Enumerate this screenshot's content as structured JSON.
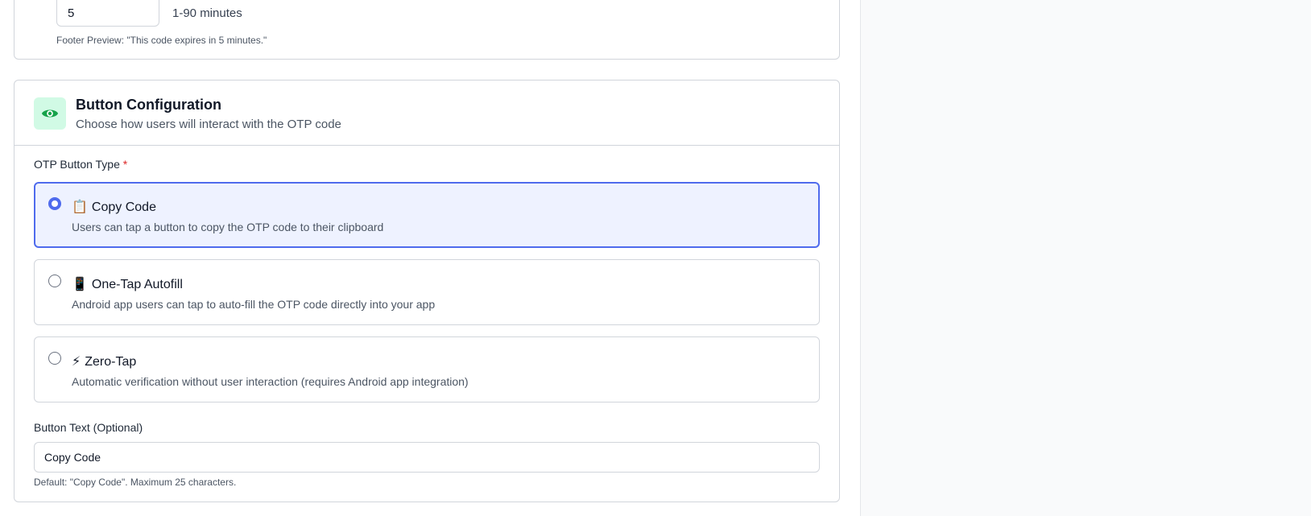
{
  "expiry": {
    "value": "5",
    "range_hint": "1-90 minutes",
    "footer_preview": "Footer Preview: \"This code expires in 5 minutes.\""
  },
  "button_config": {
    "icon": "eye-icon",
    "icon_color": "#16a34a",
    "title": "Button Configuration",
    "subtitle": "Choose how users will interact with the OTP code",
    "type_label": "OTP Button Type",
    "required_marker": "*",
    "options": [
      {
        "emoji": "📋",
        "title": "Copy Code",
        "description": "Users can tap a button to copy the OTP code to their clipboard",
        "selected": true
      },
      {
        "emoji": "📱",
        "title": "One-Tap Autofill",
        "description": "Android app users can tap to auto-fill the OTP code directly into your app",
        "selected": false
      },
      {
        "emoji": "⚡",
        "title": "Zero-Tap",
        "description": "Automatic verification without user interaction (requires Android app integration)",
        "selected": false
      }
    ],
    "button_text_label": "Button Text (Optional)",
    "button_text_value": "Copy Code",
    "button_text_hint": "Default: \"Copy Code\". Maximum 25 characters."
  },
  "colors": {
    "accent": "#4f6bed",
    "selected_bg": "#eef2ff",
    "icon_bg": "#d1fae5",
    "required": "#dc2626"
  }
}
